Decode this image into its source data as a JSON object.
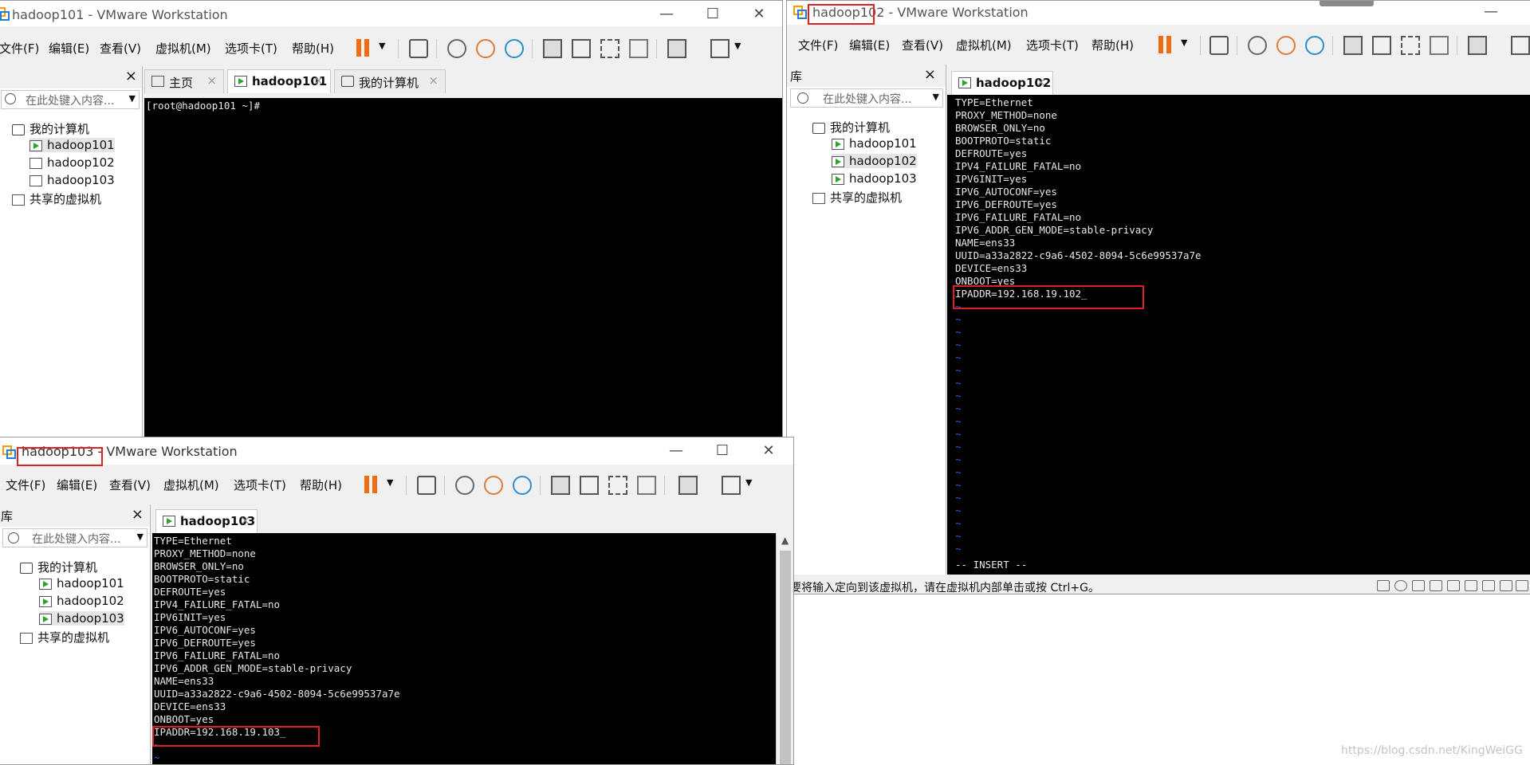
{
  "menu_items": [
    "文件(F)",
    "编辑(E)",
    "查看(V)",
    "虚拟机(M)",
    "选项卡(T)",
    "帮助(H)"
  ],
  "search_placeholder": "在此处键入内容...",
  "tree": {
    "root": "我的计算机",
    "vms": [
      "hadoop101",
      "hadoop102",
      "hadoop103"
    ],
    "shared": "共享的虚拟机"
  },
  "close_glyph": "×",
  "controls": {
    "min": "—",
    "max": "☐",
    "close": "✕"
  },
  "win1": {
    "title": "hadoop101 - VMware Workstation",
    "tabs": [
      {
        "label": "主页"
      },
      {
        "label": "hadoop101"
      },
      {
        "label": "我的计算机"
      }
    ],
    "console_line": "[root@hadoop101 ~]#"
  },
  "win2": {
    "title_vm": "hadoop102",
    "title_rest": " - VMware Workstation",
    "lib_label": "库",
    "tab": "hadoop102",
    "console": [
      "TYPE=Ethernet",
      "PROXY_METHOD=none",
      "BROWSER_ONLY=no",
      "BOOTPROTO=static",
      "DEFROUTE=yes",
      "IPV4_FAILURE_FATAL=no",
      "IPV6INIT=yes",
      "IPV6_AUTOCONF=yes",
      "IPV6_DEFROUTE=yes",
      "IPV6_FAILURE_FATAL=no",
      "IPV6_ADDR_GEN_MODE=stable-privacy",
      "NAME=ens33",
      "UUID=a33a2822-c9a6-4502-8094-5c6e99537a7e",
      "DEVICE=ens33",
      "ONBOOT=yes",
      "IPADDR=192.168.19.102_"
    ],
    "tilde": "~",
    "mode": "-- INSERT --",
    "status": "要将输入定向到该虚拟机，请在虚拟机内部单击或按 Ctrl+G。"
  },
  "win3": {
    "title_vm": "hadoop103",
    "title_rest": " - VMware Workstation",
    "lib_label": "库",
    "tab": "hadoop103",
    "console": [
      "TYPE=Ethernet",
      "PROXY_METHOD=none",
      "BROWSER_ONLY=no",
      "BOOTPROTO=static",
      "DEFROUTE=yes",
      "IPV4_FAILURE_FATAL=no",
      "IPV6INIT=yes",
      "IPV6_AUTOCONF=yes",
      "IPV6_DEFROUTE=yes",
      "IPV6_FAILURE_FATAL=no",
      "IPV6_ADDR_GEN_MODE=stable-privacy",
      "NAME=ens33",
      "UUID=a33a2822-c9a6-4502-8094-5c6e99537a7e",
      "DEVICE=ens33",
      "ONBOOT=yes",
      "IPADDR=192.168.19.103_"
    ],
    "tilde": "~"
  },
  "watermark": "https://blog.csdn.net/KingWeiGG",
  "colors": {
    "accent_orange": "#ef6c12",
    "highlight_red": "#e02020",
    "vi_tilde": "#2962ff"
  }
}
